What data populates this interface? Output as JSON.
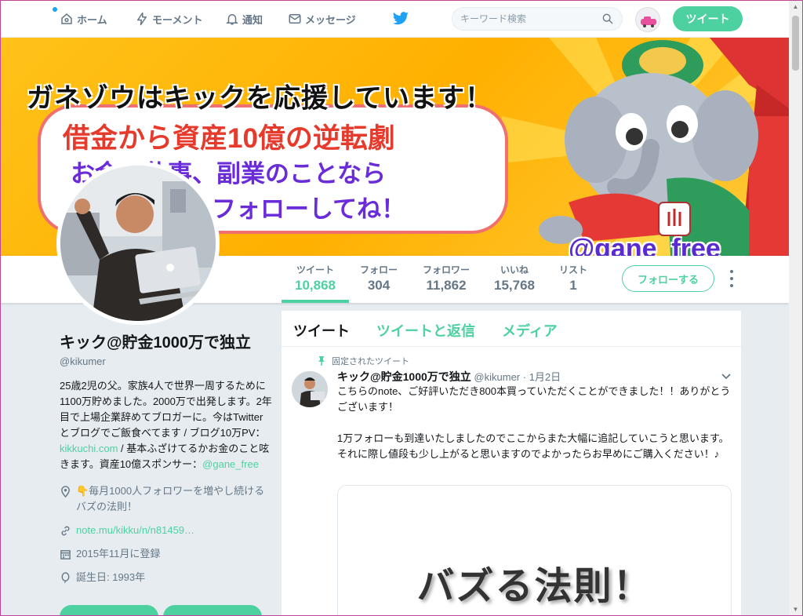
{
  "nav": {
    "home": "ホーム",
    "moments": "モーメント",
    "notifications": "通知",
    "messages": "メッセージ",
    "search_placeholder": "キーワード検索",
    "tweet_button": "ツイート",
    "accent": "#4ed1a0",
    "brand": "#1da1f2"
  },
  "banner": {
    "headline": "ガネゾウはキックを応援しています！",
    "line1": "借金から資産10億の逆転劇",
    "line2": "お金、仕事、副業のことなら",
    "line3": "フォローしてね！",
    "handle": "@gane_free"
  },
  "stats": [
    {
      "label": "ツイート",
      "value": "10,868"
    },
    {
      "label": "フォロー",
      "value": "304"
    },
    {
      "label": "フォロワー",
      "value": "11,862"
    },
    {
      "label": "いいね",
      "value": "15,768"
    },
    {
      "label": "リスト",
      "value": "1"
    }
  ],
  "follow_button": "フォローする",
  "profile": {
    "name": "キック@貯金1000万で独立",
    "handle": "@kikumer",
    "bio_a": "25歳2児の父。家族4人で世界一周するために1100万貯めました。2000万で出発します。2年目で上場企業辞めてブロガーに。今はTwitterとブログでご飯食べてます / ブログ10万PV：",
    "bio_link1": "kikkuchi.com",
    "bio_b": " / 基本ふざけてるかお金のこと呟きます。資産10億スポンサー：",
    "bio_link2": "@gane_free",
    "location": "👇毎月1000人フォロワーを増やし続けるバズの法則！",
    "url": "note.mu/kikku/n/n81459…",
    "joined": "2015年11月に登録",
    "birthday": "誕生日: 1993年"
  },
  "timeline": {
    "tabs": [
      "ツイート",
      "ツイートと返信",
      "メディア"
    ],
    "pinned_label": "固定されたツイート",
    "tweet": {
      "name": "キック@貯金1000万で独立",
      "handle": "@kikumer",
      "date": "· 1月2日",
      "text": "こちらのnote、ご好評いただき800本買っていただくことができました！！ありがとうございます！\n\n1万フォローも到達いたしましたのでここからまた大幅に追記していこうと思います。それに際し値段も少し上がると思いますのでよかったらお早めにご購入ください！♪",
      "card_title": "バズる法則！"
    }
  }
}
